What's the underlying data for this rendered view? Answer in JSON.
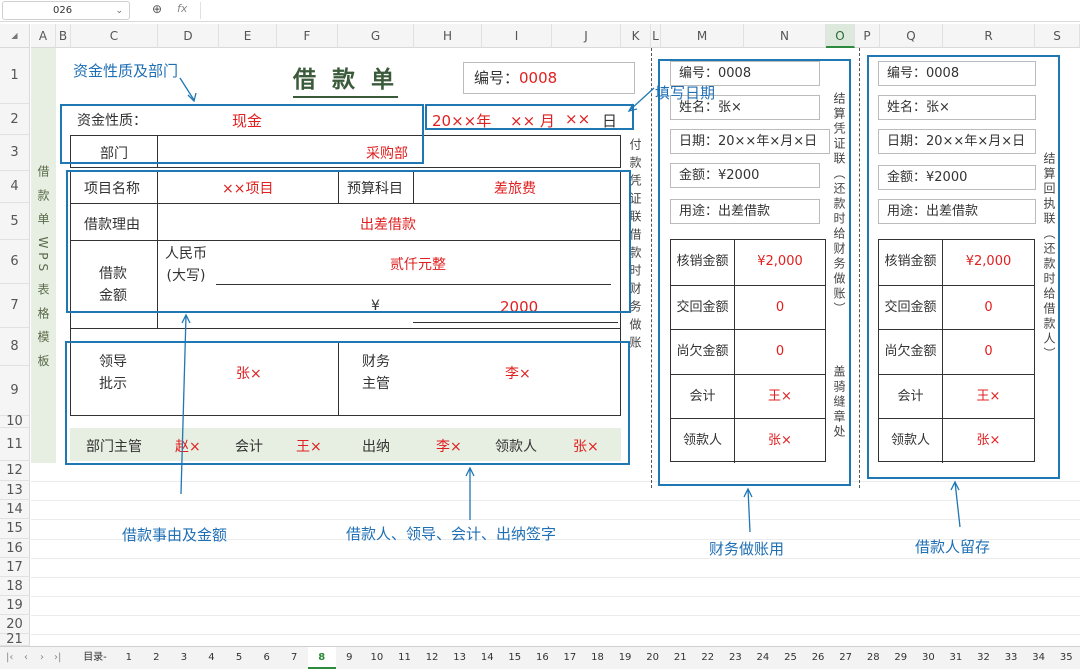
{
  "formula_bar": {
    "cell_ref": "026",
    "fx": "fx"
  },
  "columns": [
    "A",
    "B",
    "C",
    "D",
    "E",
    "F",
    "G",
    "H",
    "I",
    "J",
    "K",
    "L",
    "M",
    "N",
    "O",
    "P",
    "Q",
    "R",
    "S"
  ],
  "rows": [
    "1",
    "2",
    "3",
    "4",
    "5",
    "6",
    "7",
    "8",
    "9",
    "10",
    "11",
    "12",
    "13",
    "14",
    "15",
    "16",
    "17",
    "18",
    "19",
    "20",
    "21"
  ],
  "side_title": "借 款 单 WPS 表 格 模 板",
  "form": {
    "title": "借 款 单",
    "number_label": "编号：",
    "number_value": "0008",
    "fund_nature_label": "资金性质：",
    "fund_nature_value": "现金",
    "date_prefix": "20××年",
    "date_month": "×× 月",
    "date_day": "××",
    "date_day_label": "日",
    "dept_label": "部门",
    "dept_value": "采购部",
    "project_label": "项目名称",
    "project_value": "××项目",
    "budget_label": "预算科目",
    "budget_value": "差旅费",
    "reason_label": "借款理由",
    "reason_value": "出差借款",
    "amount_label": "借款\n金额",
    "rmb_label": "人民币\n(大写)",
    "amount_upper": "贰仟元整",
    "yen_symbol": "¥",
    "amount_value": "2000",
    "leader_label": "领导\n批示",
    "leader_value": "张×",
    "finance_label": "财务\n主管",
    "finance_value": "李×",
    "dept_head_label": "部门主管",
    "dept_head_value": "赵×",
    "accountant_label": "会计",
    "accountant_value": "王×",
    "cashier_label": "出纳",
    "cashier_value": "李×",
    "receiver_label": "领款人",
    "receiver_value": "张×",
    "vertical_note": "付款凭证联借款时财务做账"
  },
  "stub1": {
    "number": "编号：0008",
    "name": "姓名：张×",
    "date": "日期：20××年×月×日",
    "amount": "金额：¥2000",
    "purpose": "用途：出差借款",
    "rows": [
      [
        "核销金额",
        "¥2,000"
      ],
      [
        "交回金额",
        "0"
      ],
      [
        "尚欠金额",
        "0"
      ],
      [
        "会计",
        "王×"
      ],
      [
        "领款人",
        "张×"
      ]
    ],
    "vertical_note": "结算凭证联（还款时给财务做账）",
    "vertical_note2": "盖骑缝章处"
  },
  "stub2": {
    "number": "编号：0008",
    "name": "姓名：张×",
    "date": "日期：20××年×月×日",
    "amount": "金额：¥2000",
    "purpose": "用途：出差借款",
    "rows": [
      [
        "核销金额",
        "¥2,000"
      ],
      [
        "交回金额",
        "0"
      ],
      [
        "尚欠金额",
        "0"
      ],
      [
        "会计",
        "王×"
      ],
      [
        "领款人",
        "张×"
      ]
    ],
    "vertical_note": "结算回执联（还款时给借款人）"
  },
  "annotations": {
    "fund_dept": "资金性质及部门",
    "fill_date": "填写日期",
    "reason_amount": "借款事由及金额",
    "signatures": "借款人、领导、会计、出纳签字",
    "finance_use": "财务做账用",
    "borrower_keep": "借款人留存"
  },
  "tabs": {
    "first": "目录-",
    "numbers": [
      "1",
      "2",
      "3",
      "4",
      "5",
      "6",
      "7",
      "8",
      "9",
      "10",
      "11",
      "12",
      "13",
      "14",
      "15",
      "16",
      "17",
      "18",
      "19",
      "20",
      "21",
      "22",
      "23",
      "24",
      "25",
      "26",
      "27",
      "28",
      "29",
      "30",
      "31",
      "32",
      "33",
      "34",
      "35"
    ],
    "active": "8"
  },
  "colors": {
    "red": "#e02020",
    "blue": "#1f77b4",
    "green": "#2c8a3c"
  }
}
